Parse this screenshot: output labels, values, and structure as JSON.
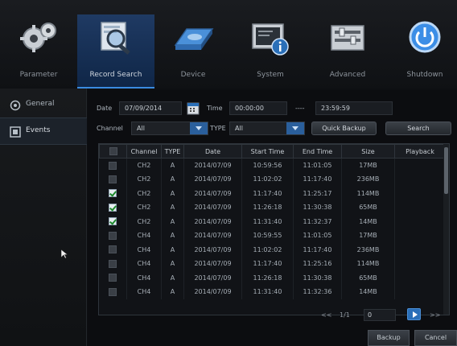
{
  "window": {
    "title": ""
  },
  "topnav": [
    {
      "label": "Parameter",
      "icon": "gears-icon"
    },
    {
      "label": "Record Search",
      "icon": "magnifier-icon"
    },
    {
      "label": "Device",
      "icon": "hard-drive-icon"
    },
    {
      "label": "System",
      "icon": "system-info-icon"
    },
    {
      "label": "Advanced",
      "icon": "advanced-settings-icon"
    },
    {
      "label": "Shutdown",
      "icon": "power-icon"
    }
  ],
  "sidebar": [
    {
      "label": "General",
      "icon": "general-icon"
    },
    {
      "label": "Events",
      "icon": "events-icon"
    }
  ],
  "filters": {
    "date_label": "Date",
    "date_value": "07/09/2014",
    "time_label": "Time",
    "start_time": "00:00:00",
    "time_separator": "----",
    "end_time": "23:59:59",
    "channel_label": "Channel",
    "channel_value": "All",
    "type_label": "TYPE",
    "type_value": "All",
    "quick_backup_label": "Quick Backup",
    "search_label": "Search"
  },
  "table": {
    "columns": [
      "",
      "Channel",
      "TYPE",
      "Date",
      "Start Time",
      "End Time",
      "Size",
      "Playback"
    ],
    "rows": [
      {
        "checked": false,
        "channel": "CH2",
        "type": "A",
        "date": "2014/07/09",
        "start": "10:59:56",
        "end": "11:01:05",
        "size": "17MB"
      },
      {
        "checked": false,
        "channel": "CH2",
        "type": "A",
        "date": "2014/07/09",
        "start": "11:02:02",
        "end": "11:17:40",
        "size": "236MB"
      },
      {
        "checked": true,
        "channel": "CH2",
        "type": "A",
        "date": "2014/07/09",
        "start": "11:17:40",
        "end": "11:25:17",
        "size": "114MB"
      },
      {
        "checked": true,
        "channel": "CH2",
        "type": "A",
        "date": "2014/07/09",
        "start": "11:26:18",
        "end": "11:30:38",
        "size": "65MB"
      },
      {
        "checked": true,
        "channel": "CH2",
        "type": "A",
        "date": "2014/07/09",
        "start": "11:31:40",
        "end": "11:32:37",
        "size": "14MB"
      },
      {
        "checked": false,
        "channel": "CH4",
        "type": "A",
        "date": "2014/07/09",
        "start": "10:59:55",
        "end": "11:01:05",
        "size": "17MB"
      },
      {
        "checked": false,
        "channel": "CH4",
        "type": "A",
        "date": "2014/07/09",
        "start": "11:02:02",
        "end": "11:17:40",
        "size": "236MB"
      },
      {
        "checked": false,
        "channel": "CH4",
        "type": "A",
        "date": "2014/07/09",
        "start": "11:17:40",
        "end": "11:25:16",
        "size": "114MB"
      },
      {
        "checked": false,
        "channel": "CH4",
        "type": "A",
        "date": "2014/07/09",
        "start": "11:26:18",
        "end": "11:30:38",
        "size": "65MB"
      },
      {
        "checked": false,
        "channel": "CH4",
        "type": "A",
        "date": "2014/07/09",
        "start": "11:31:40",
        "end": "11:32:36",
        "size": "14MB"
      }
    ]
  },
  "pager": {
    "prev": "<<",
    "page": "1/1",
    "input_value": "0",
    "next": ">>"
  },
  "actions": {
    "backup_label": "Backup",
    "cancel_label": "Cancel"
  },
  "colors": {
    "accent": "#2a6fb8",
    "active_tab": "#1f3a63",
    "checkmark": "#1f8a2e"
  }
}
